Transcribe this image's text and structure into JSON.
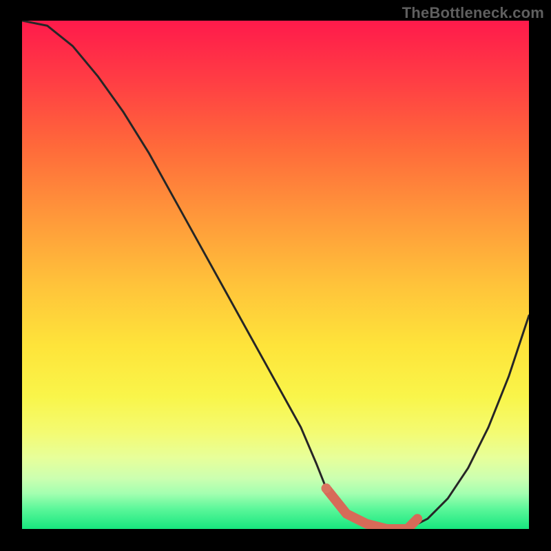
{
  "watermark": "TheBottleneck.com",
  "colors": {
    "background": "#000000",
    "curve": "#262626",
    "marker": "#d9745f",
    "marker_stroke": "#d76a58"
  },
  "chart_data": {
    "type": "line",
    "title": "",
    "xlabel": "",
    "ylabel": "",
    "xlim": [
      0,
      100
    ],
    "ylim": [
      0,
      100
    ],
    "series": [
      {
        "name": "bottleneck-curve",
        "x": [
          0,
          5,
          10,
          15,
          20,
          25,
          30,
          35,
          40,
          45,
          50,
          55,
          58,
          60,
          64,
          68,
          72,
          76,
          80,
          84,
          88,
          92,
          96,
          100
        ],
        "values": [
          100,
          99,
          95,
          89,
          82,
          74,
          65,
          56,
          47,
          38,
          29,
          20,
          13,
          8,
          3,
          1,
          0,
          0,
          2,
          6,
          12,
          20,
          30,
          42
        ]
      }
    ],
    "marker": {
      "name": "highlight-segment",
      "x": [
        60,
        64,
        68,
        72,
        76,
        78
      ],
      "values": [
        8,
        3,
        1,
        0,
        0,
        2
      ]
    },
    "gradient_note": "Background vertical gradient encodes y-value: red≈high, green≈low"
  }
}
